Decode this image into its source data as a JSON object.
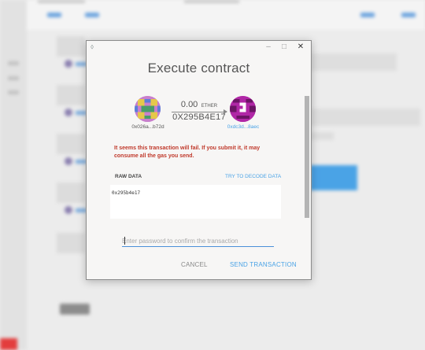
{
  "modal": {
    "title": "Execute contract",
    "from_address": "0x026a...b72d",
    "amount": "0.00",
    "unit": "ETHER",
    "contract_address": "0X295B4E17",
    "to_address": "0xdc3d...8aec",
    "warning": "It seems this transaction will fail. If you submit it, it may consume all the gas you send.",
    "raw_data_label": "RAW DATA",
    "decode_link": "TRY TO DECODE DATA",
    "raw_data": "0x295b4e17",
    "password_placeholder": "Enter password to confirm the transaction",
    "cancel_label": "CANCEL",
    "send_label": "SEND TRANSACTION"
  },
  "window_controls": {
    "minimize": "–",
    "maximize": "□",
    "close": "✕"
  },
  "icons": {
    "app": "mist-icon",
    "arrow": "arrow-right-icon"
  },
  "colors": {
    "accent": "#4aa3e6",
    "warning": "#c0392b"
  }
}
